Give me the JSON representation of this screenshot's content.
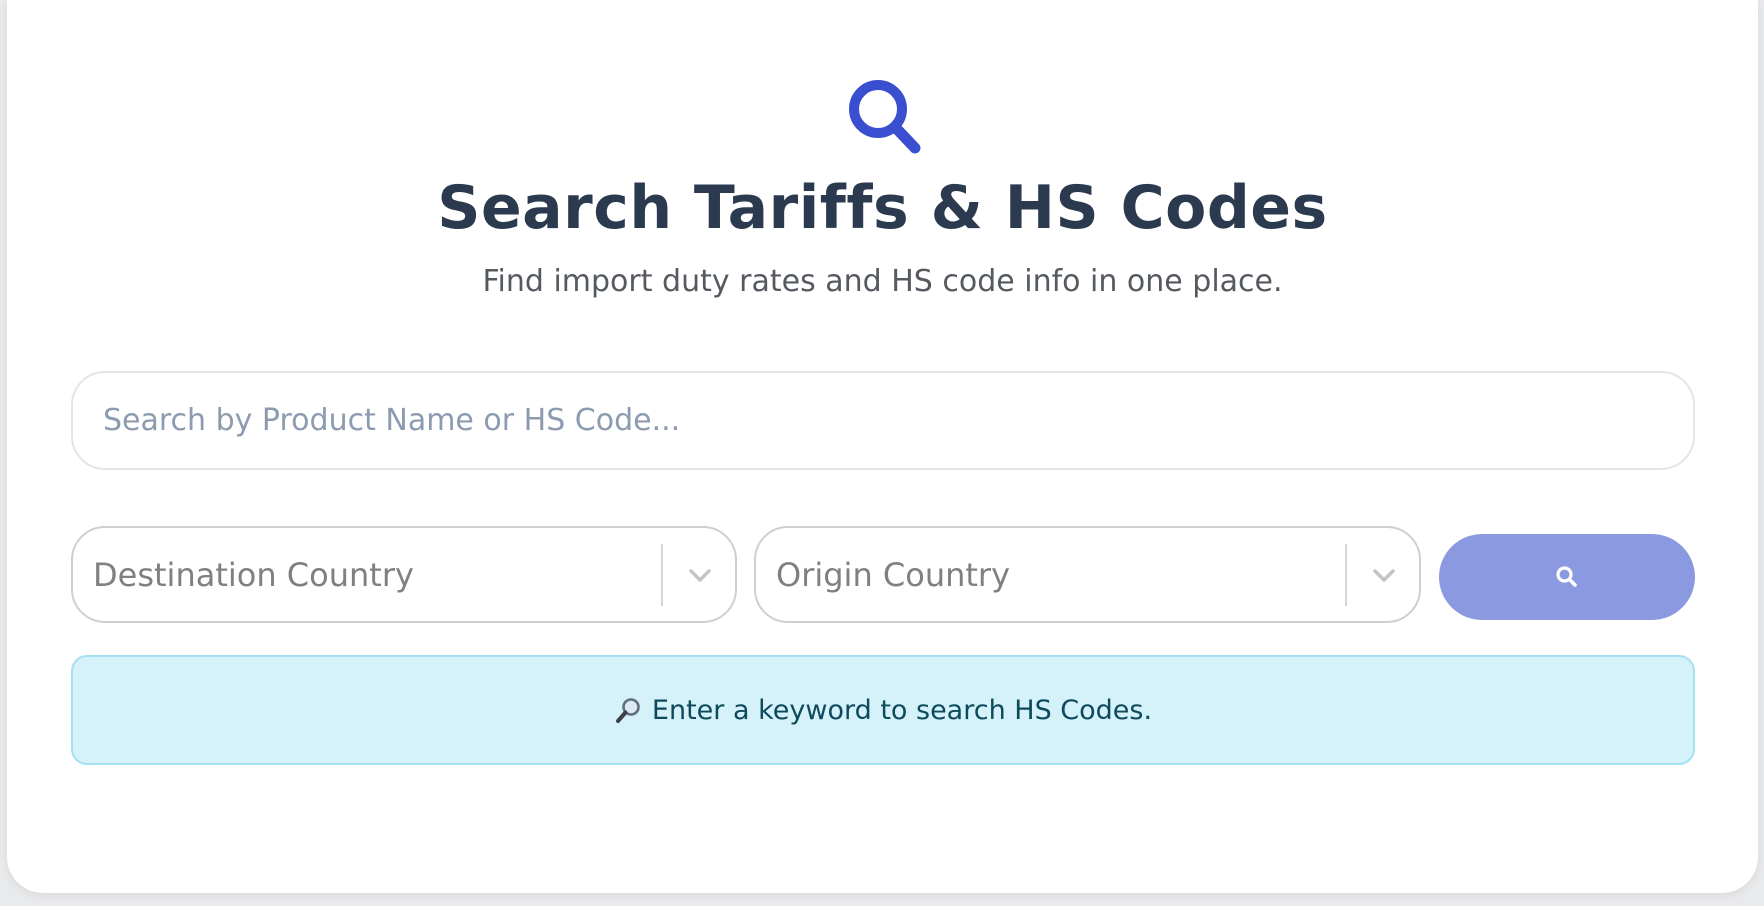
{
  "header": {
    "icon": "search-icon",
    "title": "Search Tariffs & HS Codes",
    "subtitle": "Find import duty rates and HS code info in one place."
  },
  "search": {
    "placeholder": "Search by Product Name or HS Code...",
    "value": ""
  },
  "filters": {
    "destination_placeholder": "Destination Country",
    "origin_placeholder": "Origin Country"
  },
  "search_button": {
    "icon": "search-icon"
  },
  "info": {
    "icon": "magnifying-glass-icon",
    "message": "Enter a keyword to search HS Codes."
  },
  "colors": {
    "accent": "#3a4fd0",
    "button": "#8b9ae0",
    "title": "#2b3a4f",
    "info_bg": "#d5f1f9",
    "info_border": "#a5e1f2",
    "info_text": "#0d4a5c"
  }
}
